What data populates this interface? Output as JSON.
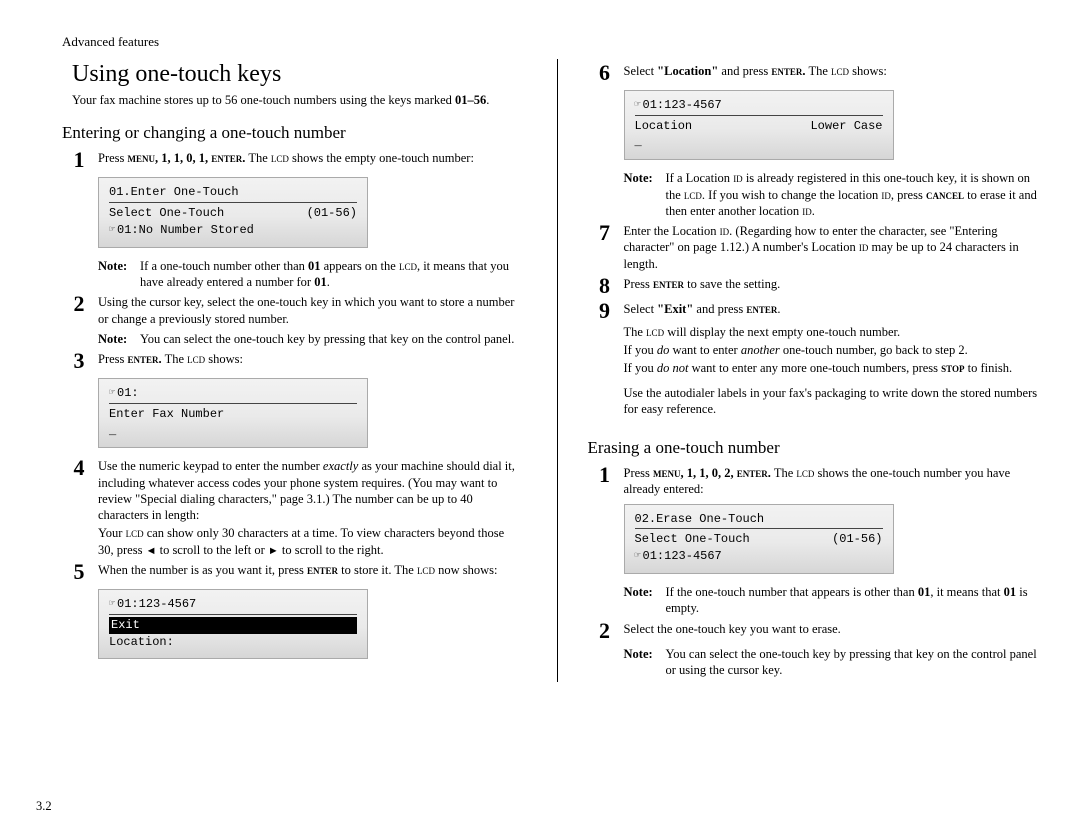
{
  "running_head": "Advanced features",
  "title": "Using one-touch keys",
  "intro_a": "Your fax machine stores up to 56 one-touch numbers using the keys marked ",
  "intro_b": "01–56",
  "intro_c": ".",
  "sub_enter": "Entering or changing a one-touch number",
  "sub_erase": "Erasing a one-touch number",
  "page_num": "3.2",
  "left": {
    "s1": {
      "num": "1",
      "a": "Press ",
      "b": "menu, 1, 1, 0, 1, enter.",
      "c": " The ",
      "d": "lcd",
      "e": " shows the empty one-touch number:"
    },
    "lcd1": {
      "l1": "01.Enter One-Touch",
      "l2a": "Select One-Touch",
      "l2b": "(01-56)",
      "l3": "01:No Number Stored"
    },
    "n1": {
      "label": "Note:",
      "a": "If a one-touch number other than ",
      "b": "01",
      "c": " appears on the ",
      "d": "lcd",
      "e": ", it means that you have already entered a number for ",
      "f": "01",
      "g": "."
    },
    "s2": {
      "num": "2",
      "t": "Using the cursor key, select the one-touch key in which you want to store a number or change a previously stored number."
    },
    "n2": {
      "label": "Note:",
      "t": "You can select the one-touch key by pressing that key on the control panel."
    },
    "s3": {
      "num": "3",
      "a": "Press ",
      "b": "enter.",
      "c": " The ",
      "d": "lcd",
      "e": " shows:"
    },
    "lcd3": {
      "l1": "01:",
      "l2": "Enter Fax Number",
      "l3": "_"
    },
    "s4": {
      "num": "4",
      "a": "Use the numeric keypad to enter the number ",
      "b": "exactly",
      "c": " as your machine should dial it, including whatever access codes your phone system requires. (You may want to review \"Special dialing characters,\" page 3.1.) The number can be up to 40 characters in length:"
    },
    "extra4": {
      "a": "Your ",
      "b": "lcd",
      "c": " can show only 30 characters at a time. To view characters beyond those 30, press ",
      "d": "◄",
      "e": " to scroll to the left or ",
      "f": "►",
      "g": " to scroll to the right."
    },
    "s5": {
      "num": "5",
      "a": "When the number is as you want it, press ",
      "b": "enter",
      "c": " to store it. The ",
      "d": "lcd",
      "e": " now shows:"
    },
    "lcd5": {
      "l1": "01:123-4567",
      "l2": "Exit",
      "l3": "Location:"
    }
  },
  "right": {
    "s6": {
      "num": "6",
      "a": "Select ",
      "b": "\"Location\"",
      "c": " and press ",
      "d": "enter.",
      "e": " The ",
      "f": "lcd",
      "g": " shows:"
    },
    "lcd6": {
      "l1": "01:123-4567",
      "l2a": "Location",
      "l2b": "Lower Case",
      "l3": "_"
    },
    "n6": {
      "label": "Note:",
      "a": "If a Location ",
      "b": "id",
      "c": " is already registered in this one-touch key, it is shown on the ",
      "d": "lcd",
      "e": ". If you wish to change the location ",
      "f": "id",
      "g": ", press ",
      "h": "cancel",
      "i": " to erase it and then enter another location ",
      "j": "id",
      "k": "."
    },
    "s7": {
      "num": "7",
      "a": "Enter the Location ",
      "b": "id",
      "c": ". (Regarding how to enter the character, see \"Entering character\" on page 1.12.)  A number's Location ",
      "d": "id",
      "e": " may be up to 24 characters in length."
    },
    "s8": {
      "num": "8",
      "a": "Press ",
      "b": "enter",
      "c": " to save the setting."
    },
    "s9": {
      "num": "9",
      "a": "Select ",
      "b": "\"Exit\"",
      "c": " and press ",
      "d": "enter",
      "e": "."
    },
    "post9a": {
      "a": "The ",
      "b": "lcd",
      "c": " will display the next empty one-touch number."
    },
    "post9b": {
      "a": "If you ",
      "b": "do",
      "c": " want to enter ",
      "d": "another",
      "e": " one-touch number, go back to step 2."
    },
    "post9c": {
      "a": "If you ",
      "b": "do not",
      "c": " want to enter any more one-touch numbers, press ",
      "d": "stop",
      "e": " to finish."
    },
    "post9d": "Use the autodialer labels in your fax's packaging to write down the stored numbers for easy reference.",
    "e1": {
      "num": "1",
      "a": "Press ",
      "b": "menu, 1, 1, 0, 2, enter.",
      "c": " The ",
      "d": "lcd",
      "e": " shows the one-touch number you have already entered:"
    },
    "lcdE": {
      "l1": "02.Erase One-Touch",
      "l2a": "Select One-Touch",
      "l2b": "(01-56)",
      "l3": "01:123-4567"
    },
    "ne1": {
      "label": "Note:",
      "a": "If the one-touch number that appears is other than ",
      "b": "01",
      "c": ", it means that ",
      "d": "01",
      "e": " is empty."
    },
    "e2": {
      "num": "2",
      "t": "Select the one-touch key you want to erase."
    },
    "ne2": {
      "label": "Note:",
      "t": "You can select the one-touch key by pressing that key on the control panel or using the cursor key."
    }
  }
}
